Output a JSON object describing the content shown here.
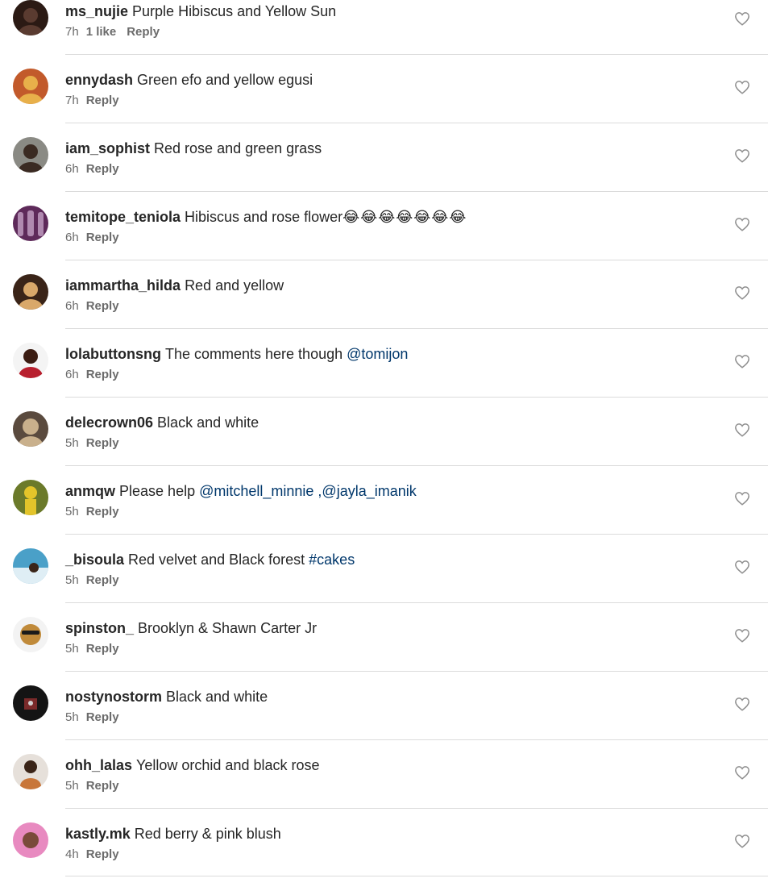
{
  "comments": [
    {
      "username": "ms_nujie",
      "text": "Purple Hibiscus and Yellow Sun",
      "time": "7h",
      "likes": "1 like",
      "reply": "Reply",
      "avatar_color": "#2b1a14",
      "avatar_accent": "#5a3b30"
    },
    {
      "username": "ennydash",
      "text": "Green efo and yellow egusi",
      "time": "7h",
      "likes": "",
      "reply": "Reply",
      "avatar_color": "#c25a2b",
      "avatar_accent": "#e8b04a"
    },
    {
      "username": "iam_sophist",
      "text": "Red rose and green grass",
      "time": "6h",
      "likes": "",
      "reply": "Reply",
      "avatar_color": "#8a8a84",
      "avatar_accent": "#3a2a22"
    },
    {
      "username": "temitope_teniola",
      "text": "Hibiscus and rose flower",
      "emojis": "😂😂😂😂😂😂😂",
      "time": "6h",
      "likes": "",
      "reply": "Reply",
      "avatar_color": "#5e2a5a",
      "avatar_accent": "#b08ab0"
    },
    {
      "username": "iammartha_hilda",
      "text": "Red and yellow",
      "time": "6h",
      "likes": "",
      "reply": "Reply",
      "avatar_color": "#3a2418",
      "avatar_accent": "#d9a86a"
    },
    {
      "username": "lolabuttonsng",
      "text": "The comments here though ",
      "mention": "@tomijon",
      "time": "6h",
      "likes": "",
      "reply": "Reply",
      "avatar_color": "#b81f2e",
      "avatar_accent": "#3b1c12"
    },
    {
      "username": "delecrown06",
      "text": "Black and white",
      "time": "5h",
      "likes": "",
      "reply": "Reply",
      "avatar_color": "#5a4a3e",
      "avatar_accent": "#c9b08c"
    },
    {
      "username": "anmqw",
      "text": "Please help ",
      "mention": "@mitchell_minnie ,@jayla_imanik",
      "time": "5h",
      "likes": "",
      "reply": "Reply",
      "avatar_color": "#6b7a2a",
      "avatar_accent": "#e3c42a"
    },
    {
      "username": "_bisoula",
      "text": "Red velvet and Black forest ",
      "hashtag": "#cakes",
      "time": "5h",
      "likes": "",
      "reply": "Reply",
      "avatar_color": "#4aa0c8",
      "avatar_accent": "#dfeef5"
    },
    {
      "username": "spinston_",
      "text": "Brooklyn & Shawn Carter Jr",
      "time": "5h",
      "likes": "",
      "reply": "Reply",
      "avatar_color": "#f3f3f3",
      "avatar_accent": "#c08a3a"
    },
    {
      "username": "nostynostorm",
      "text": "Black and white",
      "time": "5h",
      "likes": "",
      "reply": "Reply",
      "avatar_color": "#141414",
      "avatar_accent": "#7a2a2a"
    },
    {
      "username": "ohh_lalas",
      "text": "Yellow orchid and black rose",
      "time": "5h",
      "likes": "",
      "reply": "Reply",
      "avatar_color": "#e6e0da",
      "avatar_accent": "#3a2418"
    },
    {
      "username": "kastly.mk",
      "text": "Red berry & pink blush",
      "time": "4h",
      "likes": "",
      "reply": "Reply",
      "avatar_color": "#e88ac0",
      "avatar_accent": "#7a4a3a"
    }
  ]
}
